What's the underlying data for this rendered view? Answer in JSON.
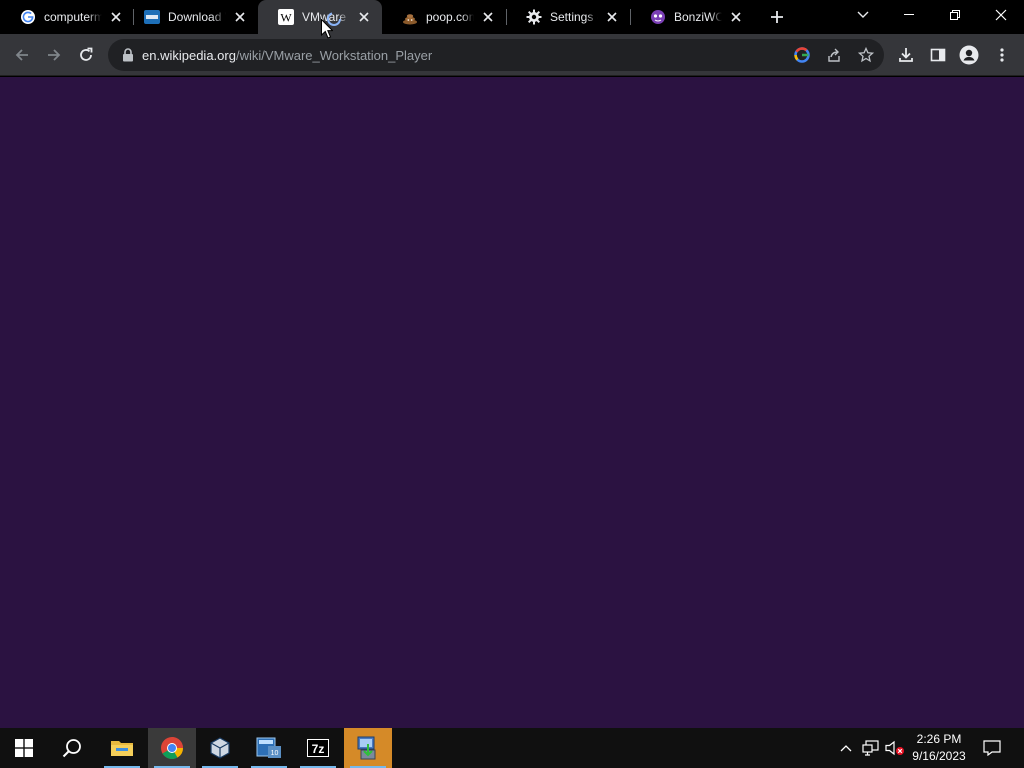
{
  "browser": {
    "tabs": [
      {
        "title": "computerme",
        "icon": "google-icon",
        "active": false
      },
      {
        "title": "Download VMware",
        "icon": "vmware-icon",
        "active": false
      },
      {
        "title": "VMware Wo",
        "icon": "wikipedia-icon",
        "active": true,
        "loading": true
      },
      {
        "title": "poop.com",
        "icon": "poop-icon",
        "active": false
      },
      {
        "title": "Settings - A",
        "icon": "gear-icon",
        "active": false
      },
      {
        "title": "BonziWORLD",
        "icon": "bonzi-icon",
        "active": false
      }
    ],
    "address": {
      "host": "en.wikipedia.org",
      "path": "/wiki/VMware_Workstation_Player"
    }
  },
  "page": {
    "background_color": "#2b1241"
  },
  "taskbar": {
    "apps": [
      "file-explorer-icon",
      "chrome-icon",
      "virtualbox-icon",
      "calculator-icon",
      "7zip-icon",
      "installer-icon"
    ],
    "clock": {
      "time": "2:26 PM",
      "date": "9/16/2023"
    },
    "zip_label": "7z"
  }
}
